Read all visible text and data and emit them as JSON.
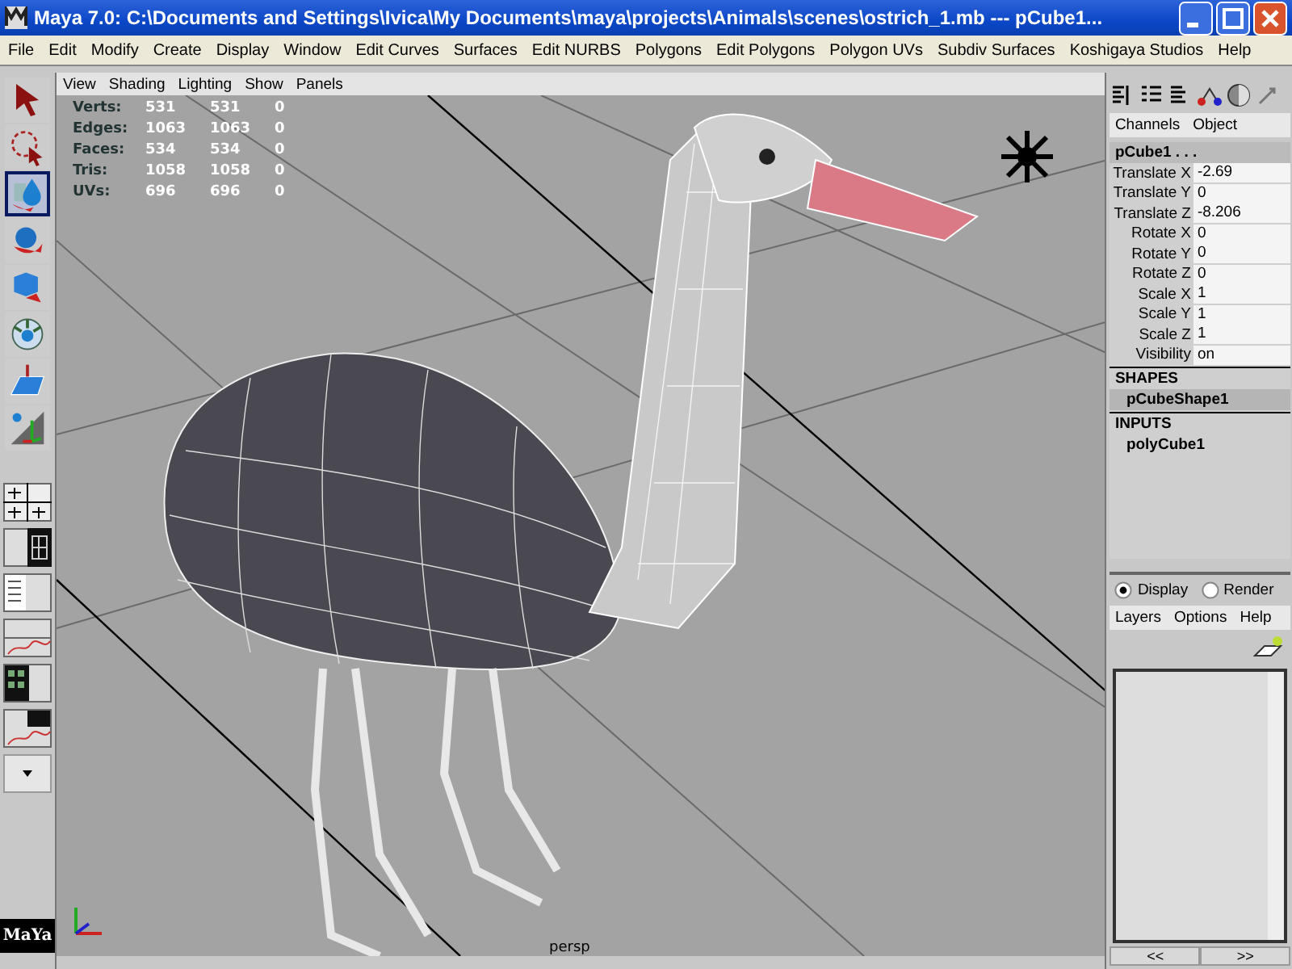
{
  "window": {
    "title": "Maya 7.0: C:\\Documents and Settings\\Ivica\\My Documents\\maya\\projects\\Animals\\scenes\\ostrich_1.mb   ---   pCube1..."
  },
  "menu": [
    "File",
    "Edit",
    "Modify",
    "Create",
    "Display",
    "Window",
    "Edit Curves",
    "Surfaces",
    "Edit NURBS",
    "Polygons",
    "Edit Polygons",
    "Polygon UVs",
    "Subdiv Surfaces",
    "Koshigaya Studios",
    "Help"
  ],
  "tools": [
    {
      "kind": "select",
      "selected": false
    },
    {
      "kind": "lasso",
      "selected": false
    },
    {
      "kind": "paint",
      "selected": true
    },
    {
      "kind": "rotate",
      "selected": false
    },
    {
      "kind": "scale",
      "selected": false
    },
    {
      "kind": "manip",
      "selected": false
    },
    {
      "kind": "soft",
      "selected": false
    },
    {
      "kind": "last",
      "selected": false
    }
  ],
  "viewport": {
    "menu": [
      "View",
      "Shading",
      "Lighting",
      "Show",
      "Panels"
    ],
    "stats": [
      {
        "label": "Verts:",
        "values": [
          "531",
          "531",
          "0"
        ]
      },
      {
        "label": "Edges:",
        "values": [
          "1063",
          "1063",
          "0"
        ]
      },
      {
        "label": "Faces:",
        "values": [
          "534",
          "534",
          "0"
        ]
      },
      {
        "label": "Tris:",
        "values": [
          "1058",
          "1058",
          "0"
        ]
      },
      {
        "label": "UVs:",
        "values": [
          "696",
          "696",
          "0"
        ]
      }
    ],
    "camera": "persp"
  },
  "logo": "MaYa",
  "channel_box": {
    "menu": [
      "Channels",
      "Object"
    ],
    "node": "pCube1 . . .",
    "attributes": [
      {
        "name": "Translate X",
        "value": "-2.69"
      },
      {
        "name": "Translate Y",
        "value": "0"
      },
      {
        "name": "Translate Z",
        "value": "-8.206"
      },
      {
        "name": "Rotate X",
        "value": "0"
      },
      {
        "name": "Rotate Y",
        "value": "0"
      },
      {
        "name": "Rotate Z",
        "value": "0"
      },
      {
        "name": "Scale X",
        "value": "1"
      },
      {
        "name": "Scale Y",
        "value": "1"
      },
      {
        "name": "Scale Z",
        "value": "1"
      },
      {
        "name": "Visibility",
        "value": "on"
      }
    ],
    "sections": [
      {
        "title": "SHAPES",
        "item": "pCubeShape1",
        "selected": true
      },
      {
        "title": "INPUTS",
        "item": "polyCube1",
        "selected": false
      }
    ]
  },
  "layer_editor": {
    "modes": [
      {
        "label": "Display",
        "selected": true
      },
      {
        "label": "Render",
        "selected": false
      }
    ],
    "menu": [
      "Layers",
      "Options",
      "Help"
    ],
    "nav": [
      "<<",
      ">>"
    ]
  }
}
